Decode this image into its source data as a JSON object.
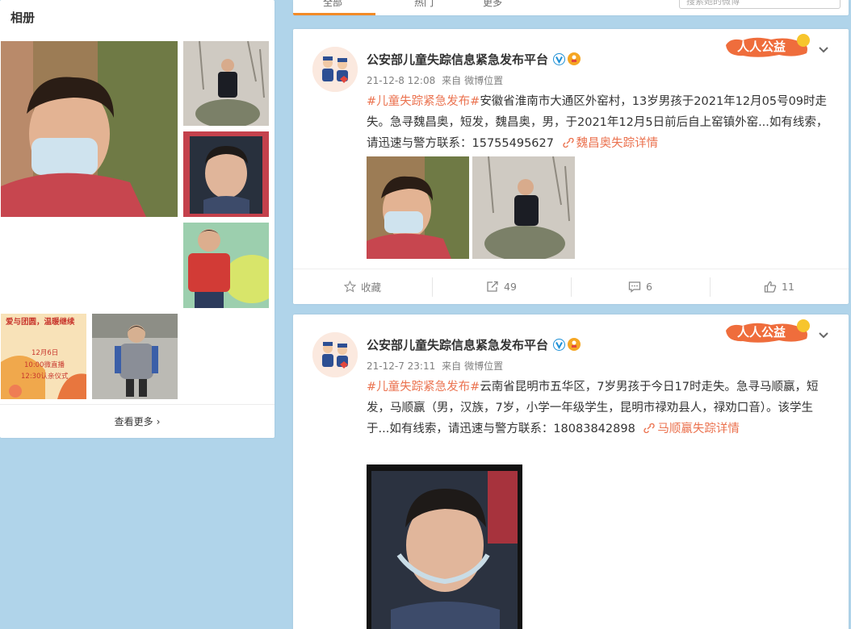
{
  "album": {
    "title": "相册",
    "see_more": "查看更多",
    "promo_line1": "爱与团圆，温暖继续",
    "promo_line2": "12月6日",
    "promo_line3": "10:00微直播",
    "promo_line4": "12:30认亲仪式"
  },
  "tabs": {
    "items": [
      "全部",
      "热门",
      "更多"
    ],
    "search_placeholder": "搜索她的微博"
  },
  "posts": [
    {
      "author": "公安部儿童失踪信息紧急发布平台",
      "verified_icon": "v-verified-icon",
      "time": "21-12-8 12:08",
      "source_prefix": "来自",
      "source": "微博位置",
      "badge": "人人公益",
      "hashtag": "#儿童失踪紧急发布#",
      "body": "安徽省淮南市大通区外窑村，13岁男孩于2021年12月05号09时走失。急寻魏昌奥，短发，魏昌奥，男，于2021年12月5日前后自上窑镇外窑...如有线索，请迅速与警方联系：15755495627",
      "link": "魏昌奥失踪详情",
      "actions": {
        "favorite": "收藏",
        "repost": "49",
        "comment": "6",
        "like": "11"
      }
    },
    {
      "author": "公安部儿童失踪信息紧急发布平台",
      "verified_icon": "v-verified-icon",
      "time": "21-12-7 23:11",
      "source_prefix": "来自",
      "source": "微博位置",
      "badge": "人人公益",
      "hashtag": "#儿童失踪紧急发布#",
      "body": "云南省昆明市五华区，7岁男孩于今日17时走失。急寻马顺赢，短发，马顺赢（男，汉族，7岁，小学一年级学生，昆明市禄劝县人，禄劝口音）。该学生于...如有线索，请迅速与警方联系：18083842898",
      "link": "马顺赢失踪详情"
    }
  ],
  "colors": {
    "accent": "#eb7350",
    "tab_accent": "#f28b27",
    "page_bg": "#b0d4ea",
    "meta": "#808080"
  }
}
